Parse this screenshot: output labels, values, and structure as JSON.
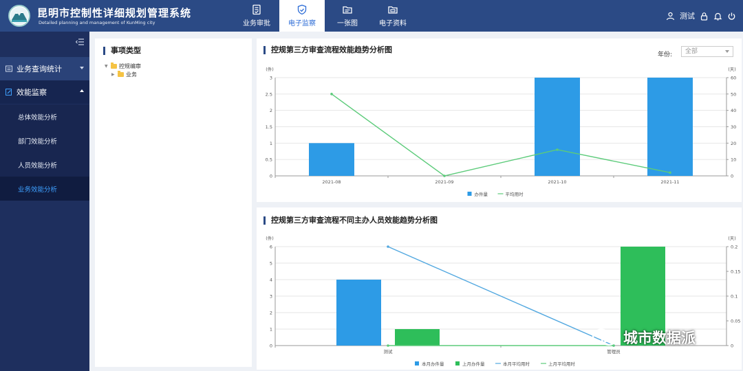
{
  "header": {
    "title": "昆明市控制性详细规划管理系统",
    "subtitle": "Detailed planning and management of KunMing city",
    "nav": [
      {
        "label": "业务审批",
        "icon": "document-check-icon",
        "active": false
      },
      {
        "label": "电子监察",
        "icon": "shield-check-icon",
        "active": true
      },
      {
        "label": "一张图",
        "icon": "map-folder-icon",
        "active": false
      },
      {
        "label": "电子资料",
        "icon": "file-folder-icon",
        "active": false
      }
    ],
    "user": "测试"
  },
  "sidebar": {
    "groups": [
      {
        "label": "业务查询统计",
        "icon": "list-icon",
        "expanded": false
      },
      {
        "label": "效能监察",
        "icon": "edit-icon",
        "expanded": true
      }
    ],
    "items": [
      {
        "label": "总体效能分析",
        "active": false
      },
      {
        "label": "部门效能分析",
        "active": false
      },
      {
        "label": "人员效能分析",
        "active": false
      },
      {
        "label": "业务效能分析",
        "active": true
      }
    ]
  },
  "tree": {
    "title": "事项类型",
    "root": "控规编审",
    "child": "业务"
  },
  "colors": {
    "header_bg": "#2b4a85",
    "sidebar_bg": "#1e2f5e",
    "bar_blue": "#2d9be6",
    "bar_green": "#2ebe5a",
    "line_green": "#5ccb7a",
    "line_blue": "#52a8e0"
  },
  "chart1": {
    "title": "控规第三方审查流程效能趋势分析图",
    "year_label": "年份:",
    "year_value": "全部",
    "left_unit": "(件)",
    "right_unit": "(天)",
    "left_ticks": [
      "0",
      "0.5",
      "1",
      "1.5",
      "2",
      "2.5",
      "3"
    ],
    "right_ticks": [
      "0",
      "10",
      "20",
      "30",
      "40",
      "50",
      "60"
    ]
  },
  "chart2": {
    "title": "控规第三方审查流程不同主办人员效能趋势分析图",
    "left_unit": "(件)",
    "right_unit": "(天)",
    "left_ticks": [
      "0",
      "1",
      "2",
      "3",
      "4",
      "5",
      "6"
    ],
    "right_ticks": [
      "0",
      "0.05",
      "0.1",
      "0.15",
      "0.2"
    ]
  },
  "chart_data": [
    {
      "type": "bar",
      "title": "控规第三方审查流程效能趋势分析图",
      "categories": [
        "2021-08",
        "2021-09",
        "2021-10",
        "2021-11"
      ],
      "series": [
        {
          "name": "办件量",
          "kind": "bar",
          "axis": "left",
          "values": [
            1,
            0,
            3,
            3
          ]
        },
        {
          "name": "平均用时",
          "kind": "line",
          "axis": "right",
          "values": [
            50,
            0,
            16,
            2
          ]
        }
      ],
      "ylim": [
        0,
        3
      ],
      "y2lim": [
        0,
        60
      ],
      "legend": "bottom-center"
    },
    {
      "type": "bar",
      "title": "控规第三方审查流程不同主办人员效能趋势分析图",
      "categories": [
        "测试",
        "管理员"
      ],
      "series": [
        {
          "name": "本月办件量",
          "kind": "bar",
          "axis": "left",
          "values": [
            4,
            0
          ]
        },
        {
          "name": "上月办件量",
          "kind": "bar",
          "axis": "left",
          "values": [
            1,
            6
          ]
        },
        {
          "name": "本月平均用时",
          "kind": "line",
          "axis": "right",
          "values": [
            0.2,
            0
          ]
        },
        {
          "name": "上月平均用时",
          "kind": "line",
          "axis": "right",
          "values": [
            0,
            0
          ]
        }
      ],
      "ylim": [
        0,
        6
      ],
      "y2lim": [
        0,
        0.2
      ],
      "legend": "bottom-center"
    }
  ],
  "watermark": "城市数据派"
}
